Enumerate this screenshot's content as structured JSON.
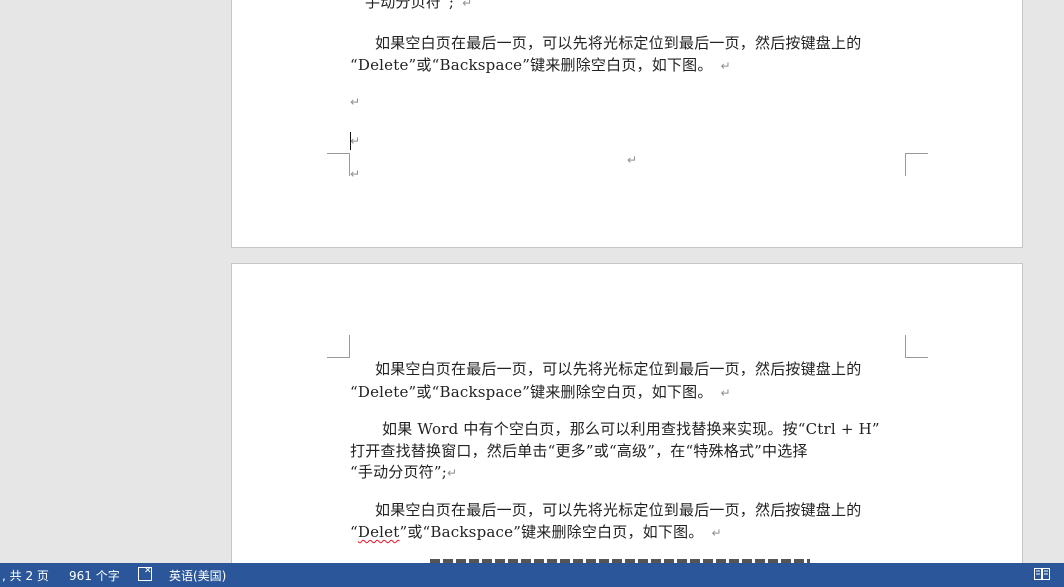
{
  "document": {
    "page1_lines": [
      "手动分页符”;",
      "如果空白页在最后一页，可以先将光标定位到最后一页，然后按键盘上的",
      "“Delete”或“Backspace”键来删除空白页，如下图。"
    ],
    "page2_lines": [
      "如果空白页在最后一页，可以先将光标定位到最后一页，然后按键盘上的",
      "“Delete”或“Backspace”键来删除空白页，如下图。",
      "如果 Word 中有个空白页，那么可以利用查找替换来实现。按“Ctrl + H”",
      "打开查找替换窗口，然后单击“更多”或“高级”，在“特殊格式”中选择",
      "“手动分页符”;",
      "如果空白页在最后一页，可以先将光标定位到最后一页，然后按键盘上的",
      "“",
      "Delet",
      "”或“Backspace”键来删除空白页，如下图。"
    ],
    "paragraph_mark": "↵"
  },
  "statusbar": {
    "page_info": ", 共 2 页",
    "word_count": "961 个字",
    "language": "英语(美国)",
    "read_mode_icon": "read-mode-icon",
    "proofing_icon": "proofing-icon"
  },
  "colors": {
    "statusbar_bg": "#2b579a",
    "workspace_bg": "#e6e6e6",
    "spell_error": "#e81123"
  }
}
